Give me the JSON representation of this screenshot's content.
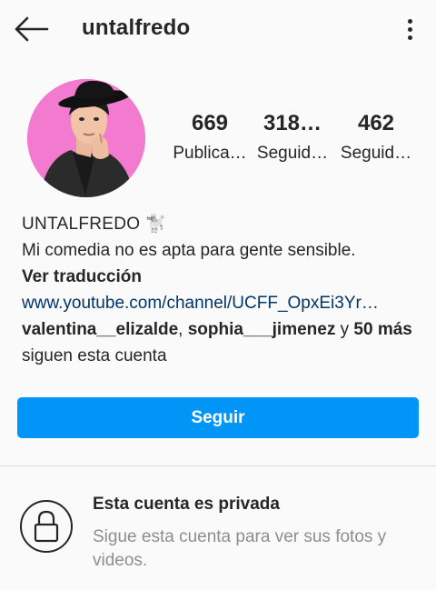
{
  "header": {
    "username": "untalfredo",
    "back_icon": "arrow-left-icon",
    "more_icon": "more-vertical-icon"
  },
  "profile": {
    "avatar_bg": "#f27bd0"
  },
  "stats": [
    {
      "value": "669",
      "label": "Publica…"
    },
    {
      "value": "318…",
      "label": "Seguid…"
    },
    {
      "value": "462",
      "label": "Seguid…"
    }
  ],
  "bio": {
    "display_name": "UNTALFREDO",
    "emoji": "🐩",
    "text": "Mi comedia no es apta para gente sensible.",
    "translate": "Ver traducción",
    "link": "www.youtube.com/channel/UCFF_OpxEi3Yr…",
    "followers_a": "valentina__elizalde",
    "sep1": ", ",
    "followers_b": "sophia___jimenez",
    "and": " y ",
    "others": "50 más",
    "suffix": " siguen esta cuenta"
  },
  "follow_button": "Seguir",
  "private": {
    "title": "Esta cuenta es privada",
    "subtitle": "Sigue esta cuenta para ver sus fotos y videos.",
    "icon": "lock-icon"
  },
  "colors": {
    "accent": "#0095f6",
    "link": "#003569",
    "muted": "#8e8e8e"
  }
}
